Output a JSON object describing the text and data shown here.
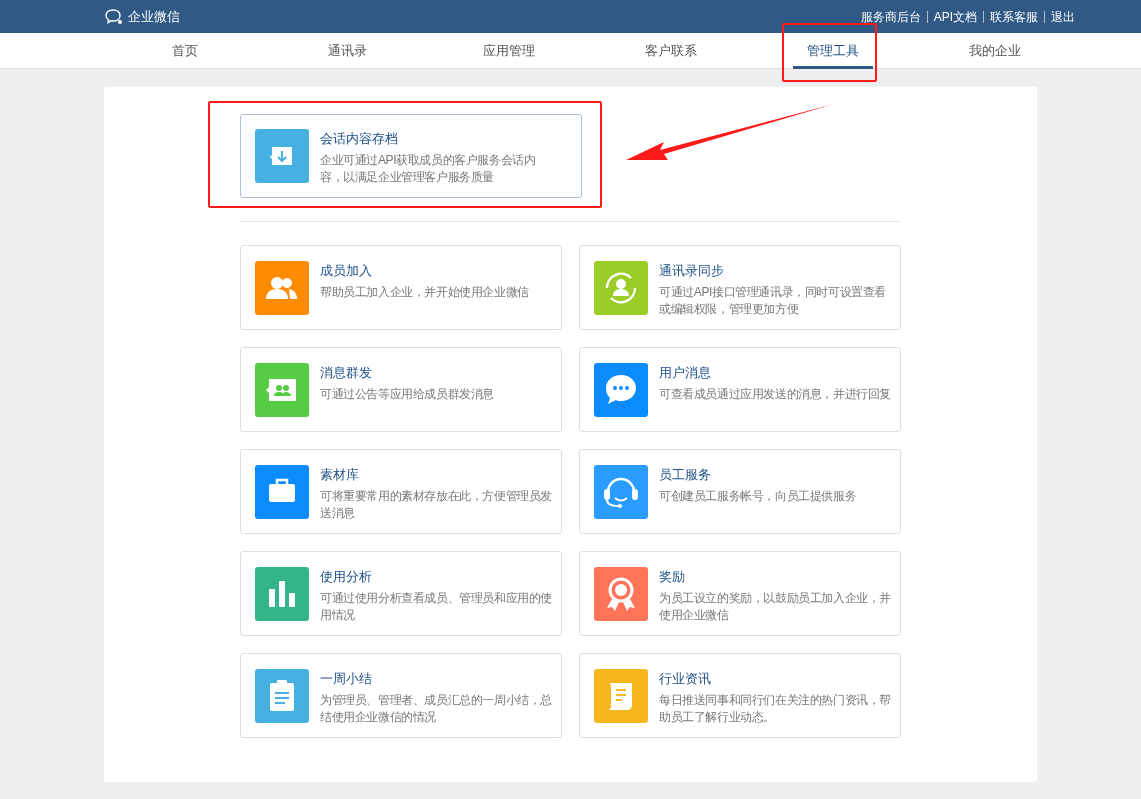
{
  "header": {
    "logo": "企业微信",
    "links": [
      "服务商后台",
      "API文档",
      "联系客服",
      "退出"
    ]
  },
  "nav": [
    {
      "label": "首页",
      "selected": false
    },
    {
      "label": "通讯录",
      "selected": false
    },
    {
      "label": "应用管理",
      "selected": false
    },
    {
      "label": "客户联系",
      "selected": false
    },
    {
      "label": "管理工具",
      "selected": true
    },
    {
      "label": "我的企业",
      "selected": false
    }
  ],
  "featured": {
    "title": "会话内容存档",
    "description": "企业可通过API获取成员的客户服务会话内容，以满足企业管理客户服务质量",
    "color": "#46b1e0"
  },
  "tools": [
    {
      "title": "成员加入",
      "description": "帮助员工加入企业，并开始使用企业微信",
      "color": "#ff8c00"
    },
    {
      "title": "通讯录同步",
      "description": "可通过API接口管理通讯录，同时可设置查看或编辑权限，管理更加方便",
      "color": "#9acd28"
    },
    {
      "title": "消息群发",
      "description": "可通过公告等应用给成员群发消息",
      "color": "#55cc44"
    },
    {
      "title": "用户消息",
      "description": "可查看成员通过应用发送的消息，并进行回复",
      "color": "#0a8cff"
    },
    {
      "title": "素材库",
      "description": "可将重要常用的素材存放在此，方便管理员发送消息",
      "color": "#0a8cff"
    },
    {
      "title": "员工服务",
      "description": "可创建员工服务帐号，向员工提供服务",
      "color": "#2a9cff"
    },
    {
      "title": "使用分析",
      "description": "可通过使用分析查看成员、管理员和应用的使用情况",
      "color": "#34b48a"
    },
    {
      "title": "奖励",
      "description": "为员工设立的奖励，以鼓励员工加入企业，并使用企业微信",
      "color": "#ff7458"
    },
    {
      "title": "一周小结",
      "description": "为管理员、管理者、成员汇总的一周小结，总结使用企业微信的情况",
      "color": "#46b1e0"
    },
    {
      "title": "行业资讯",
      "description": "每日推送同事和同行们在关注的热门资讯，帮助员工了解行业动态。",
      "color": "#f7b51e"
    }
  ]
}
